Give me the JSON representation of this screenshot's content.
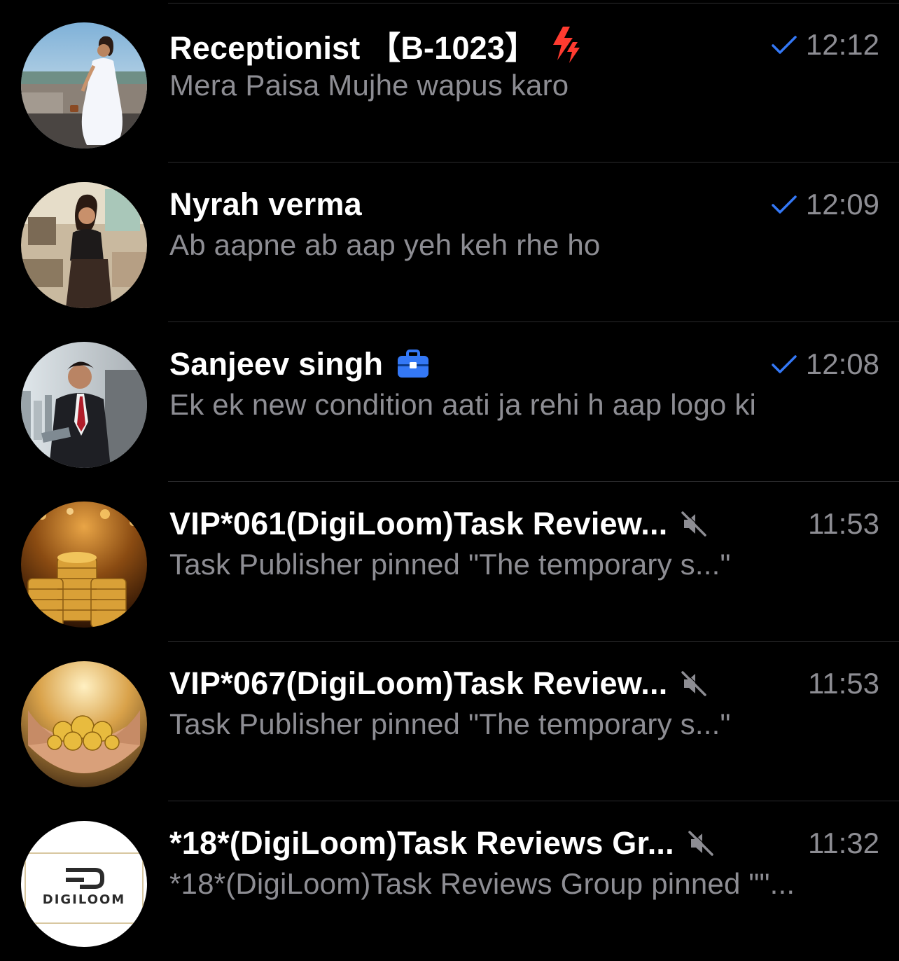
{
  "colors": {
    "background": "#000000",
    "title": "#ffffff",
    "secondary": "#8d8d93",
    "accent_blue": "#3478f6",
    "divider": "#2b2b2d",
    "lightning_red": "#ff3b30"
  },
  "chats": [
    {
      "title": "Receptionist 【B-1023】",
      "preview": "Mera Paisa Mujhe wapus karo",
      "time": "12:12",
      "badge_icon": "lightning-icon",
      "status_icon": "single-check-icon",
      "avatar_icon": "woman-white-dress-photo"
    },
    {
      "title": "Nyrah verma",
      "preview": "Ab aapne ab aap yeh keh rhe ho",
      "time": "12:09",
      "status_icon": "single-check-icon",
      "avatar_icon": "woman-cafe-photo"
    },
    {
      "title": "Sanjeev singh",
      "preview": "Ek ek new condition aati ja rehi h aap logo ki",
      "time": "12:08",
      "badge_icon": "briefcase-icon",
      "status_icon": "single-check-icon",
      "avatar_icon": "man-suit-photo"
    },
    {
      "title": "VIP*061(DigiLoom)Task Review...",
      "preview": "Task Publisher pinned \"The temporary s...\"",
      "time": "11:53",
      "badge_icon": "muted-speaker-icon",
      "avatar_icon": "gold-coins-photo"
    },
    {
      "title": "VIP*067(DigiLoom)Task Review...",
      "preview": "Task Publisher pinned \"The temporary s...\"",
      "time": "11:53",
      "badge_icon": "muted-speaker-icon",
      "avatar_icon": "hands-with-coins-photo"
    },
    {
      "title": "*18*(DigiLoom)Task Reviews Gr...",
      "preview": "*18*(DigiLoom)Task Reviews Group pinned \"\"...",
      "time": "11:32",
      "badge_icon": "muted-speaker-icon",
      "avatar_icon": "digiloom-logo",
      "avatar_text": "DIGILOOM"
    }
  ]
}
